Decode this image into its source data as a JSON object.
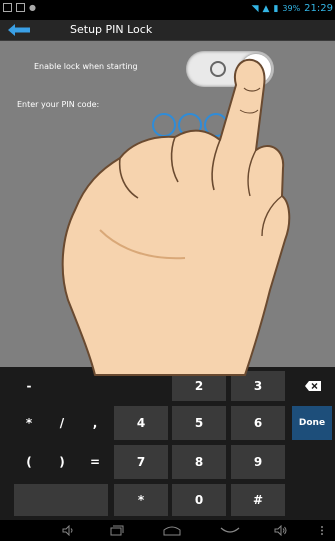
{
  "status_bar": {
    "time": "21:29",
    "battery": "39%",
    "icons": [
      "screenshot-icon",
      "message-icon",
      "notification-icon",
      "wifi-icon",
      "signal-icon",
      "battery-icon"
    ]
  },
  "title_bar": {
    "title": "Setup PIN Lock",
    "back_icon": "back-arrow-icon"
  },
  "settings": {
    "lock_label": "Enable lock when starting",
    "lock_enabled": true,
    "pin_label": "Enter your PIN code:",
    "pin_slots": 4
  },
  "keyboard": {
    "row1": [
      "-",
      "",
      "",
      "",
      "2",
      "3",
      "backspace-icon"
    ],
    "row2": [
      "*",
      "/",
      ",",
      "4",
      "5",
      "6",
      "Done"
    ],
    "row3": [
      "(",
      ")",
      "=",
      "7",
      "8",
      "9",
      ""
    ],
    "row4": [
      "",
      "*",
      "0",
      "#",
      ""
    ]
  },
  "navigation": {
    "icons": [
      "volume-down-icon",
      "recent-apps-icon",
      "home-icon",
      "back-icon",
      "volume-up-icon",
      "menu-icon"
    ]
  },
  "colors": {
    "accent": "#33b5e5",
    "pin_ring": "#2f8cd8",
    "content_bg": "#7f7f7f",
    "key_bg": "#3a3a3a",
    "done_bg": "#1d4e7a"
  }
}
